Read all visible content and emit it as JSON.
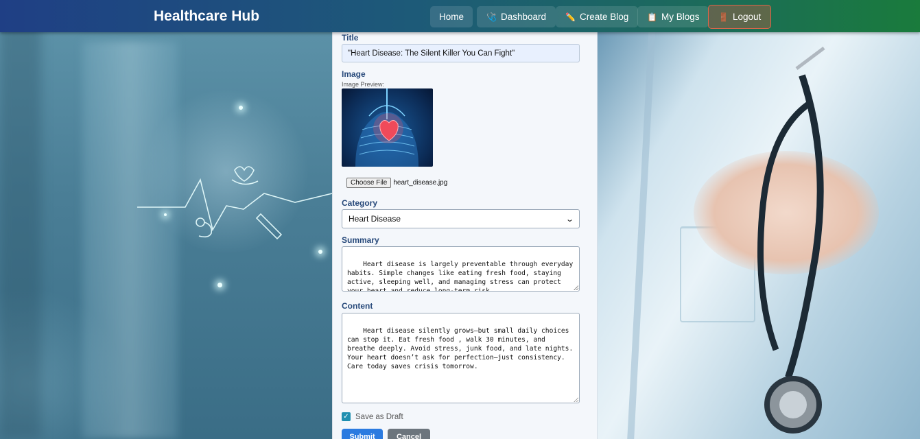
{
  "nav": {
    "brand": "Healthcare Hub",
    "items": [
      {
        "label": "Home",
        "icon": ""
      },
      {
        "label": "Dashboard",
        "icon": "🩺"
      },
      {
        "label": "Create Blog",
        "icon": "✏️"
      },
      {
        "label": "My Blogs",
        "icon": "📋"
      },
      {
        "label": "Logout",
        "icon": "🚪"
      }
    ]
  },
  "form": {
    "title_label": "Title",
    "title_value": "\"Heart Disease: The Silent Killer You Can Fight\"",
    "image_label": "Image",
    "preview_label": "Image Preview:",
    "choose_file_label": "Choose File",
    "file_name": "heart_disease.jpg",
    "category_label": "Category",
    "category_value": "Heart Disease",
    "summary_label": "Summary",
    "summary_value": "Heart disease is largely preventable through everyday habits. Simple changes like eating fresh food, staying active, sleeping well, and managing stress can protect your heart and reduce long-term risk",
    "content_label": "Content",
    "content_value": "Heart disease silently grows—but small daily choices can stop it. Eat fresh food , walk 30 minutes, and breathe deeply. Avoid stress, junk food, and late nights. Your heart doesn’t ask for perfection—just consistency. Care today saves crisis tomorrow.",
    "draft_label": "Save as Draft",
    "draft_checked": true,
    "submit_label": "Submit",
    "cancel_label": "Cancel"
  },
  "colors": {
    "nav_start": "#1f3f85",
    "nav_end": "#1a7b3c",
    "label": "#27497a",
    "submit": "#2b7be0",
    "cancel": "#6c757d",
    "checkbox": "#1f8fb0"
  }
}
